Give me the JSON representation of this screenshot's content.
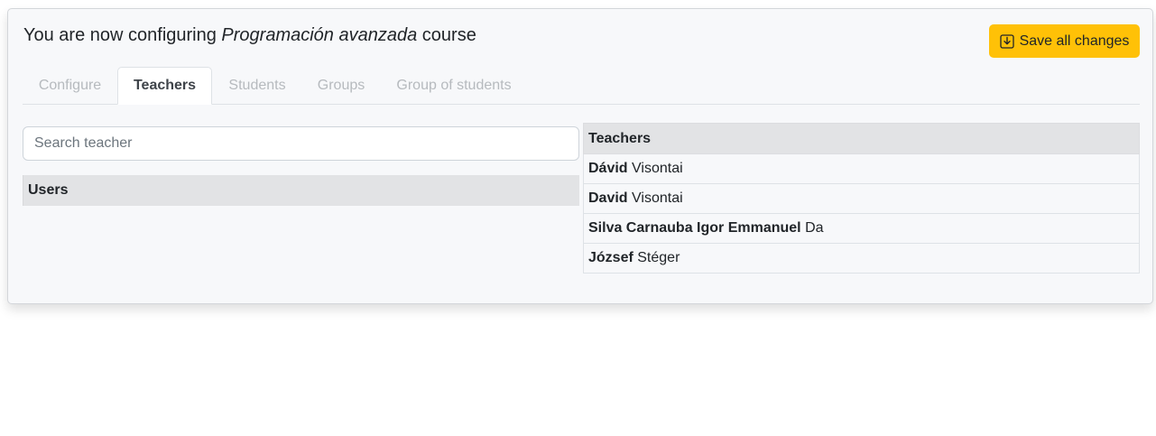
{
  "header": {
    "title_prefix": "You are now configuring",
    "course_name": "Programación avanzada",
    "title_suffix": "course"
  },
  "toolbar": {
    "save_label": "Save all changes",
    "save_icon": "download-icon",
    "accent_color": "#ffc107"
  },
  "tabs": [
    {
      "label": "Configure",
      "active": false
    },
    {
      "label": "Teachers",
      "active": true
    },
    {
      "label": "Students",
      "active": false
    },
    {
      "label": "Groups",
      "active": false
    },
    {
      "label": "Group of students",
      "active": false
    }
  ],
  "search": {
    "placeholder": "Search teacher",
    "value": ""
  },
  "users": {
    "header": "Users"
  },
  "teachers": {
    "header": "Teachers",
    "rows": [
      {
        "first": "Dávid",
        "last": "Visontai"
      },
      {
        "first": "David",
        "last": "Visontai"
      },
      {
        "first": "Silva Carnauba Igor Emmanuel",
        "last": "Da"
      },
      {
        "first": "József",
        "last": "Stéger"
      }
    ]
  }
}
